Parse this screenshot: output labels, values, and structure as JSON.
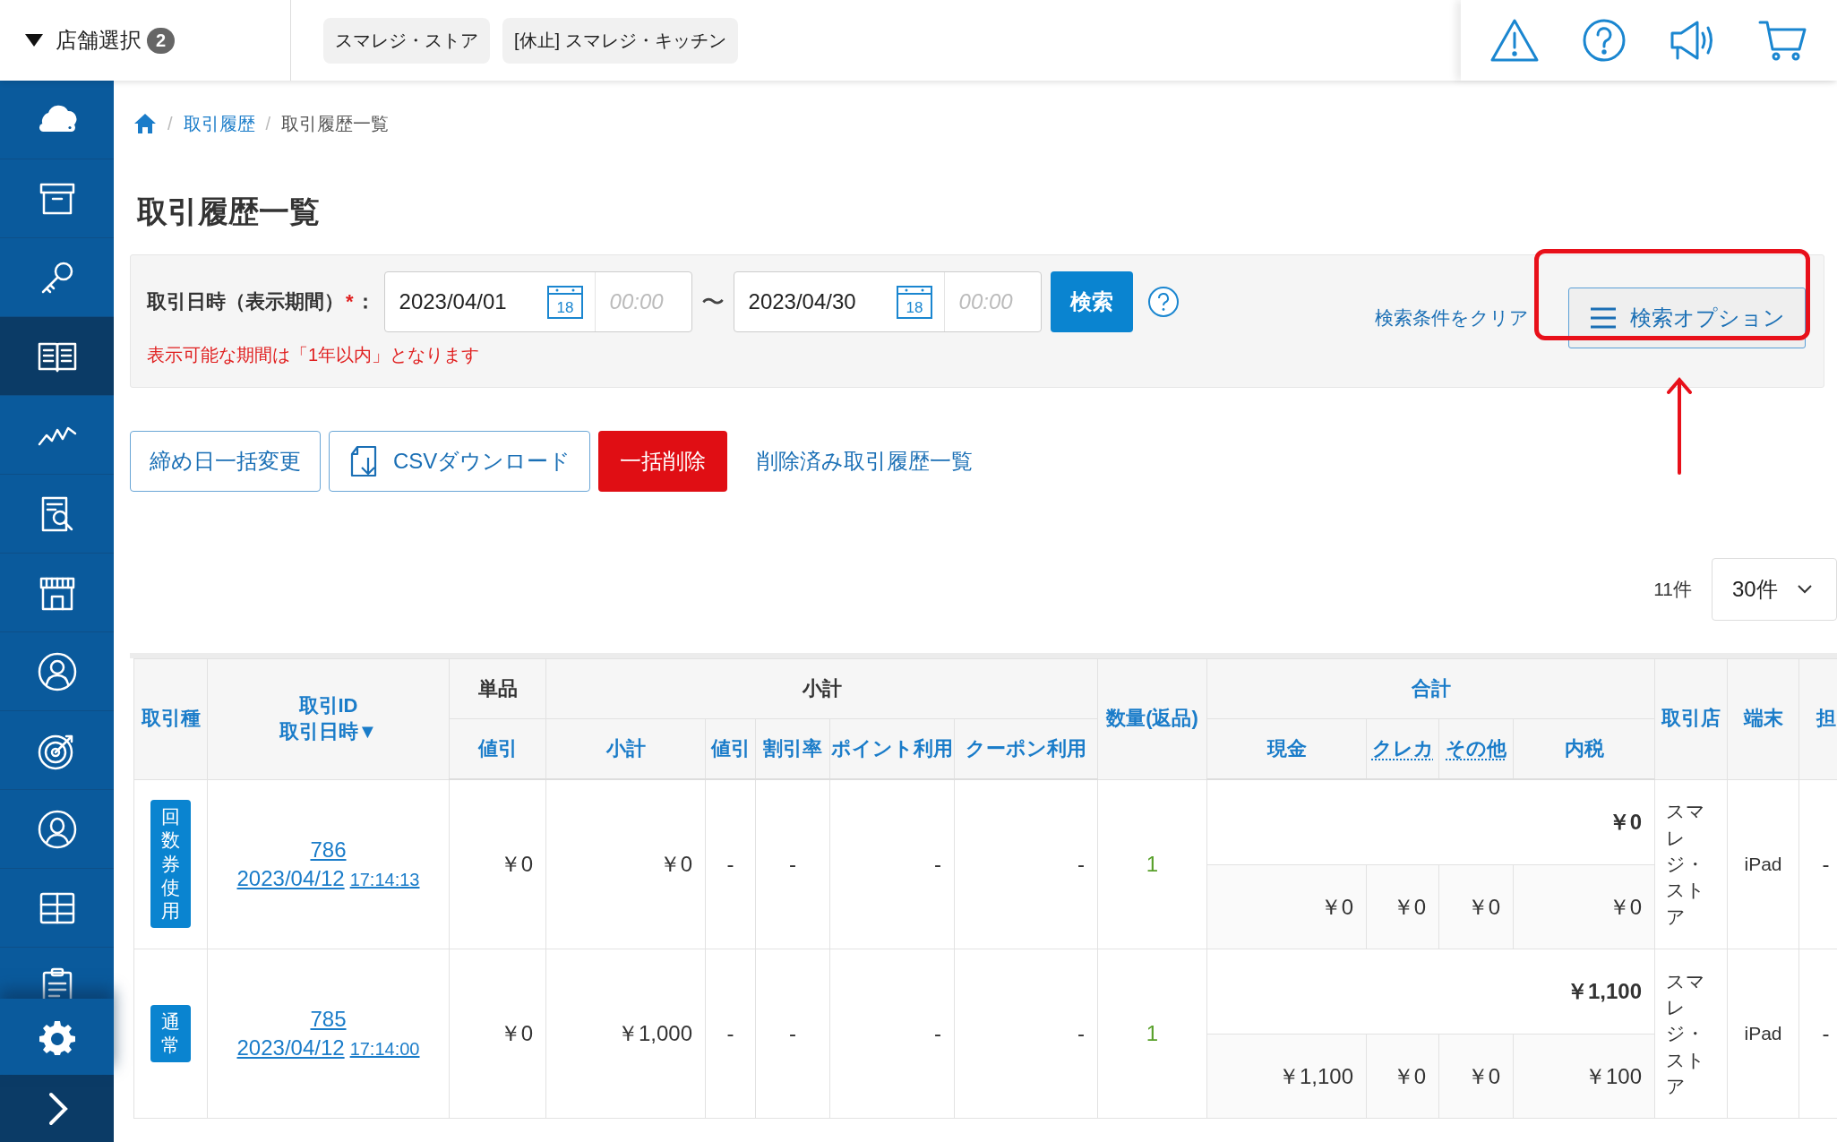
{
  "top_bar": {
    "store_select": {
      "label": "店舗選択",
      "count": "2"
    },
    "stores": [
      "スマレジ・ストア",
      "[休止] スマレジ・キッチン"
    ]
  },
  "sidebar": {
    "items": [
      {
        "selected": false
      },
      {
        "selected": false
      },
      {
        "selected": false
      },
      {
        "selected": true
      },
      {
        "selected": false
      },
      {
        "selected": false
      },
      {
        "selected": false
      },
      {
        "selected": false
      },
      {
        "selected": false
      },
      {
        "selected": false
      },
      {
        "selected": false
      },
      {
        "selected": false
      }
    ]
  },
  "breadcrumb": [
    {
      "separator": "/",
      "label": "取引履歴"
    },
    {
      "separator": "/",
      "label": "取引履歴一覧"
    }
  ],
  "title": "取引履歴一覧",
  "filter": {
    "label": "取引日時（表示期間）",
    "required_mark": "*",
    "colon": "：",
    "date_from": {
      "value": "2023/04/01",
      "calendar_day": "18",
      "time_placeholder": "00:00"
    },
    "separator": "〜",
    "date_to": {
      "value": "2023/04/30",
      "calendar_day": "18",
      "time_placeholder": "00:00"
    },
    "search_button": "検索",
    "note": "表示可能な期間は「1年以内」となります",
    "clear_link": "検索条件をクリア",
    "options_button": "検索オプション"
  },
  "actions": [
    {
      "kind": "outline",
      "label": "締め日一括変更"
    },
    {
      "kind": "download",
      "label": "CSVダウンロード"
    },
    {
      "kind": "danger",
      "label": "一括削除"
    },
    {
      "kind": "link",
      "label": "削除済み取引履歴一覧"
    }
  ],
  "result_count": "11件",
  "page_size": "30件",
  "table": {
    "columns": [
      {
        "label": [
          "取引種"
        ],
        "kind": "link"
      },
      {
        "label": [
          "取引ID",
          "取引日時▼"
        ],
        "kind": "link"
      },
      {
        "label": [
          "単品"
        ],
        "kind": "plain",
        "children": [
          {
            "label": [
              "値引"
            ],
            "kind": "link"
          }
        ]
      },
      {
        "label": [
          "小計"
        ],
        "kind": "plain",
        "children": [
          {
            "label": [
              "小計"
            ],
            "kind": "link"
          },
          {
            "label": [
              "値引"
            ],
            "kind": "link"
          },
          {
            "label": [
              "割引率"
            ],
            "kind": "link"
          },
          {
            "label": [
              "ポイント利用"
            ],
            "kind": "link"
          },
          {
            "label": [
              "クーポン利用"
            ],
            "kind": "link"
          }
        ]
      },
      {
        "label": [
          "数量(返品)"
        ],
        "kind": "link"
      },
      {
        "label": [
          "合計"
        ],
        "kind": "link",
        "children": [
          {
            "label": [
              "現金"
            ],
            "kind": "link"
          },
          {
            "label": [
              "クレカ"
            ],
            "kind": "hint"
          },
          {
            "label": [
              "その他"
            ],
            "kind": "hint"
          },
          {
            "label": [
              "内税"
            ],
            "kind": "link"
          }
        ]
      },
      {
        "label": [
          "取引店"
        ],
        "kind": "link"
      },
      {
        "label": [
          "端末"
        ],
        "kind": "link"
      },
      {
        "label": [
          "担"
        ],
        "kind": "link"
      }
    ],
    "rows": [
      {
        "type": "回数券使用",
        "id": "786",
        "date": "2023/04/12",
        "time": "17:14:13",
        "unit_discount": "￥0",
        "subtotal": "￥0",
        "subtotal_discount": "-",
        "discount_rate": "-",
        "points": "-",
        "coupon": "-",
        "quantity": "1",
        "total": "￥0",
        "cash": "￥0",
        "credit": "￥0",
        "other": "￥0",
        "tax": "￥0",
        "store": "スマレジ・ストア",
        "terminal": "iPad",
        "staff": "-"
      },
      {
        "type": "通常",
        "id": "785",
        "date": "2023/04/12",
        "time": "17:14:00",
        "unit_discount": "￥0",
        "subtotal": "￥1,000",
        "subtotal_discount": "-",
        "discount_rate": "-",
        "points": "-",
        "coupon": "-",
        "quantity": "1",
        "total": "￥1,100",
        "cash": "￥1,100",
        "credit": "￥0",
        "other": "￥0",
        "tax": "￥100",
        "store": "スマレジ・ストア",
        "terminal": "iPad",
        "staff": "-"
      }
    ]
  }
}
